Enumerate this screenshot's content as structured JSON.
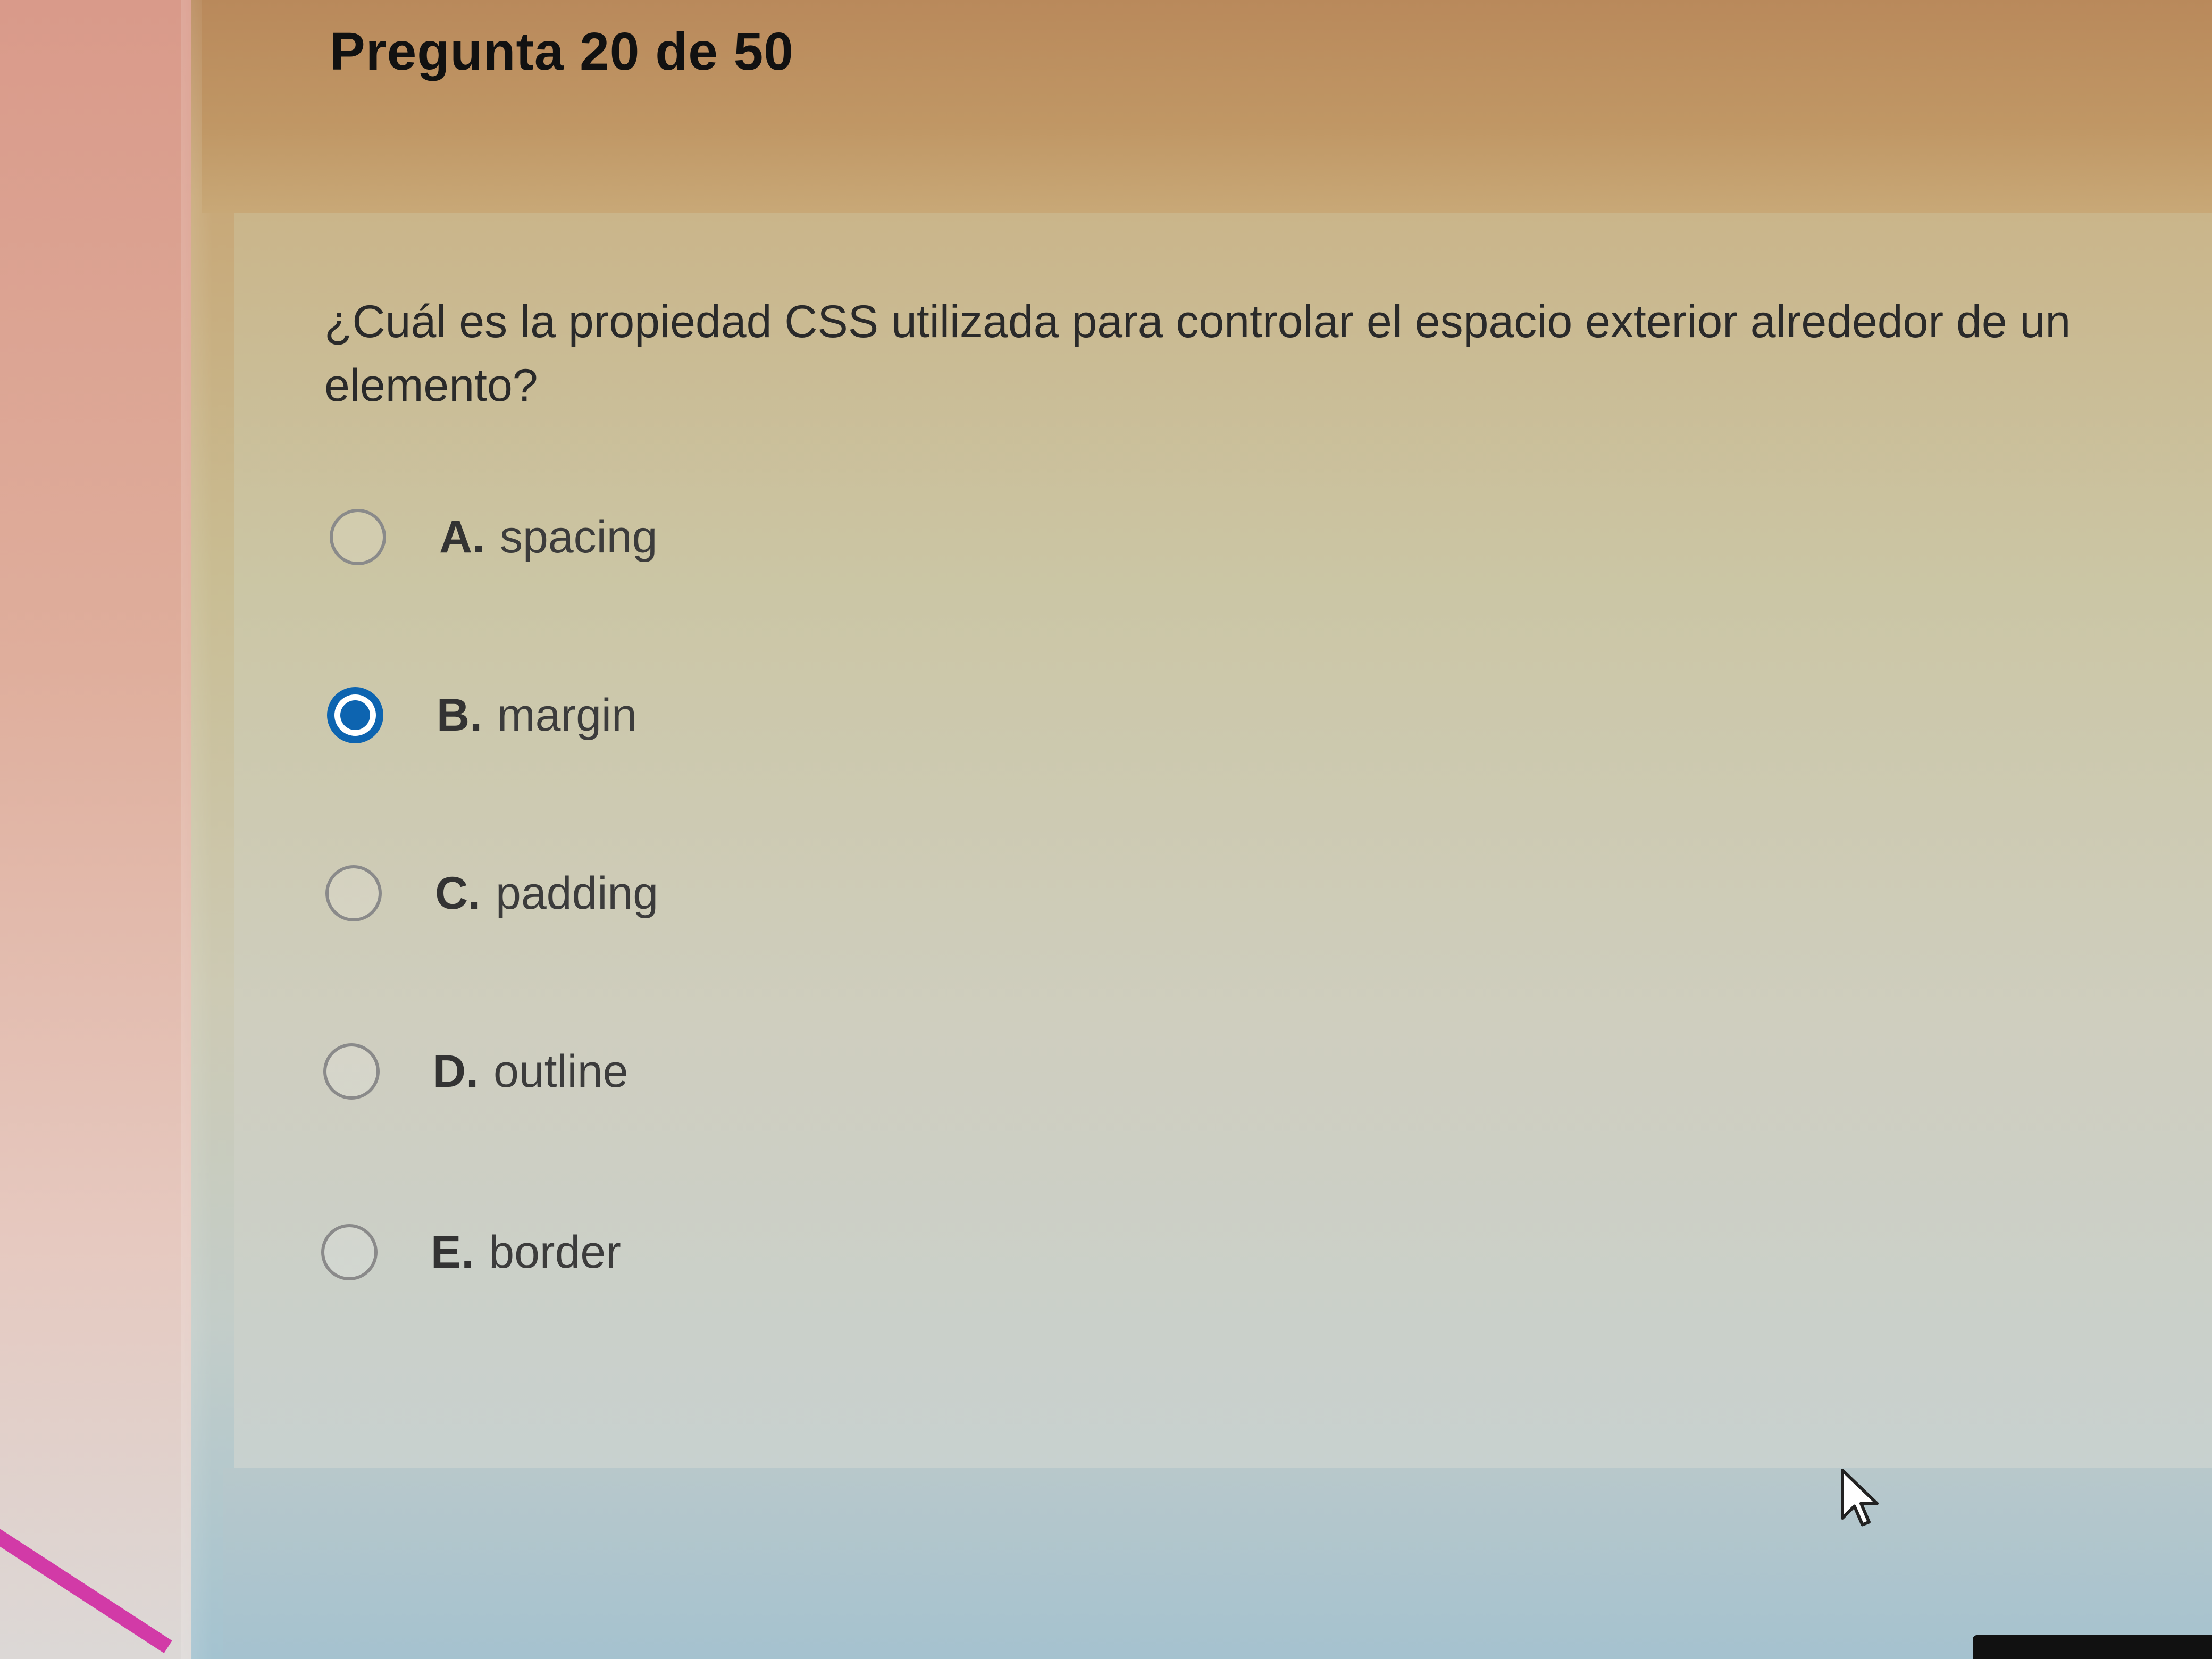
{
  "header": {
    "title": "Pregunta 20 de 50"
  },
  "question": {
    "text": "¿Cuál es la propiedad CSS utilizada para controlar el espacio exterior alrededor de un elemento?"
  },
  "options": [
    {
      "letter": "A.",
      "text": "spacing",
      "selected": false
    },
    {
      "letter": "B.",
      "text": "margin",
      "selected": true
    },
    {
      "letter": "C.",
      "text": "padding",
      "selected": false
    },
    {
      "letter": "D.",
      "text": "outline",
      "selected": false
    },
    {
      "letter": "E.",
      "text": "border",
      "selected": false
    }
  ],
  "colors": {
    "accent": "#0d64b0",
    "title_text": "#111111"
  },
  "icons": {
    "cursor": "mouse-pointer-icon"
  }
}
